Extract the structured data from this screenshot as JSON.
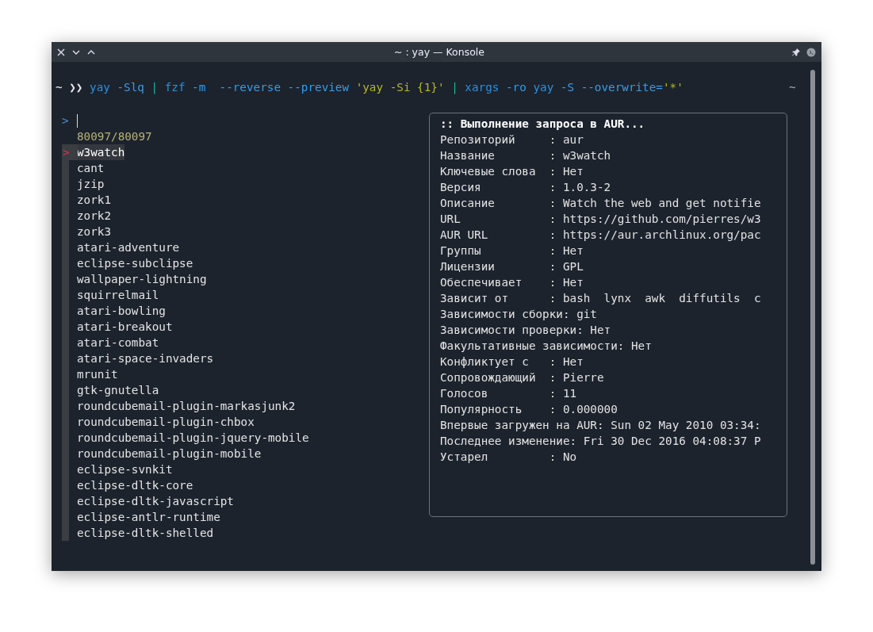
{
  "window": {
    "title": "~ : yay — Konsole"
  },
  "command": {
    "prompt": "~ ❯❯",
    "segments": [
      {
        "kind": "cmd",
        "text": "yay"
      },
      {
        "kind": "flag",
        "text": "-Slq"
      },
      {
        "kind": "pipe",
        "text": "|"
      },
      {
        "kind": "cmd",
        "text": "fzf"
      },
      {
        "kind": "flag",
        "text": "-m "
      },
      {
        "kind": "flag",
        "text": "--reverse"
      },
      {
        "kind": "flag",
        "text": "--preview"
      },
      {
        "kind": "string",
        "text": "'yay -Si {1}'"
      },
      {
        "kind": "pipe",
        "text": "|"
      },
      {
        "kind": "cmd",
        "text": "xargs"
      },
      {
        "kind": "flag",
        "text": "-ro"
      },
      {
        "kind": "cmd",
        "text": "yay"
      },
      {
        "kind": "flag",
        "text": "-S"
      },
      {
        "kind": "flag",
        "text": "--overwrite="
      },
      {
        "kind": "attached_string",
        "text": "'*'"
      }
    ],
    "right": "~"
  },
  "fzf": {
    "prompt": ">",
    "count": "80097/80097",
    "pointer": ">",
    "items": [
      {
        "text": "w3watch",
        "selected": true
      },
      {
        "text": "cant",
        "selected": false
      },
      {
        "text": "jzip",
        "selected": false
      },
      {
        "text": "zork1",
        "selected": false
      },
      {
        "text": "zork2",
        "selected": false
      },
      {
        "text": "zork3",
        "selected": false
      },
      {
        "text": "atari-adventure",
        "selected": false
      },
      {
        "text": "eclipse-subclipse",
        "selected": false
      },
      {
        "text": "wallpaper-lightning",
        "selected": false
      },
      {
        "text": "squirrelmail",
        "selected": false
      },
      {
        "text": "atari-bowling",
        "selected": false
      },
      {
        "text": "atari-breakout",
        "selected": false
      },
      {
        "text": "atari-combat",
        "selected": false
      },
      {
        "text": "atari-space-invaders",
        "selected": false
      },
      {
        "text": "mrunit",
        "selected": false
      },
      {
        "text": "gtk-gnutella",
        "selected": false
      },
      {
        "text": "roundcubemail-plugin-markasjunk2",
        "selected": false
      },
      {
        "text": "roundcubemail-plugin-chbox",
        "selected": false
      },
      {
        "text": "roundcubemail-plugin-jquery-mobile",
        "selected": false
      },
      {
        "text": "roundcubemail-plugin-mobile",
        "selected": false
      },
      {
        "text": "eclipse-svnkit",
        "selected": false
      },
      {
        "text": "eclipse-dltk-core",
        "selected": false
      },
      {
        "text": "eclipse-dltk-javascript",
        "selected": false
      },
      {
        "text": "eclipse-antlr-runtime",
        "selected": false
      },
      {
        "text": "eclipse-dltk-shelled",
        "selected": false
      }
    ]
  },
  "preview": {
    "heading": ":: Выполнение запроса в AUR...",
    "lines": [
      "Репозиторий     : aur",
      "Название        : w3watch",
      "Ключевые слова  : Нет",
      "Версия          : 1.0.3-2",
      "Описание        : Watch the web and get notifie",
      "URL             : https://github.com/pierres/w3",
      "AUR URL         : https://aur.archlinux.org/pac",
      "Группы          : Нет",
      "Лицензии        : GPL",
      "Обеспечивает    : Нет",
      "Зависит от      : bash  lynx  awk  diffutils  c",
      "Зависимости сборки: git",
      "Зависимости проверки: Нет",
      "Факультативные зависимости: Нет",
      "Конфликтует с   : Нет",
      "Сопровождающий  : Pierre",
      "Голосов         : 11",
      "Популярность    : 0.000000",
      "Впервые загружен на AUR: Sun 02 May 2010 03:34:",
      "Последнее изменение: Fri 30 Dec 2016 04:08:37 P",
      "Устарел         : No"
    ]
  }
}
